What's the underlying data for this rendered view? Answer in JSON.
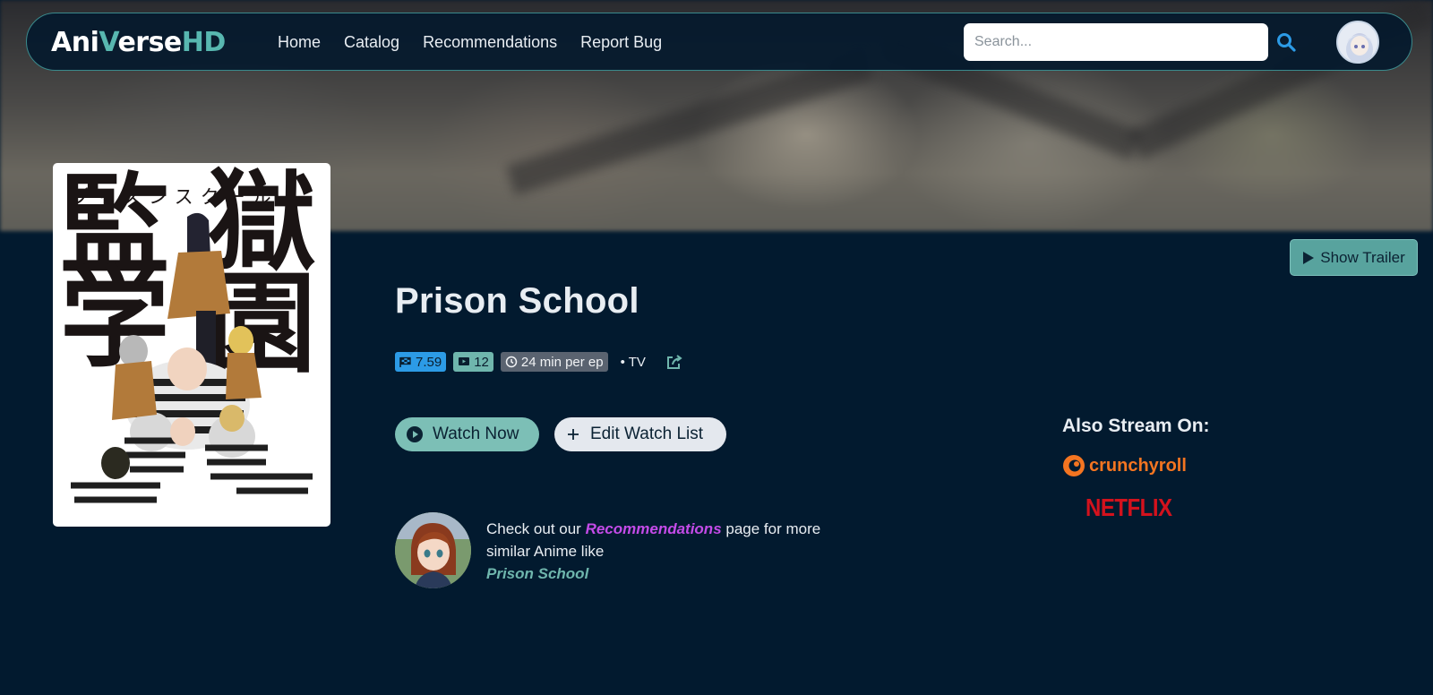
{
  "nav": {
    "logo_main": "Ani",
    "logo_v": "V",
    "logo_rest": "erse",
    "logo_hd": "HD",
    "links": [
      "Home",
      "Catalog",
      "Recommendations",
      "Report Bug"
    ],
    "search_placeholder": "Search..."
  },
  "anime": {
    "title": "Prison School",
    "score": "7.59",
    "episodes": "12",
    "duration": "24 min per ep",
    "type": "• TV"
  },
  "poster": {
    "kanji_left_top": "監",
    "kanji_right_top": "獄",
    "kanji_left_bottom": "学",
    "kanji_right_bottom": "園",
    "katakana": "プリズンスクール"
  },
  "actions": {
    "watch_now": "Watch Now",
    "edit_watch_list": "Edit Watch List",
    "show_trailer": "Show Trailer"
  },
  "recommendation": {
    "prefix": "Check out our ",
    "link": "Recommendations",
    "suffix": " page for more similar Anime like",
    "anime": "Prison School"
  },
  "streaming": {
    "title": "Also Stream On:",
    "services": [
      "crunchyroll",
      "NETFLIX"
    ]
  },
  "colors": {
    "background": "#021a2f",
    "accent_teal": "#58b7b0",
    "score_blue": "#2c9be6",
    "link_purple": "#c44be8",
    "crunchyroll_orange": "#f47521",
    "netflix_red": "#d3121d"
  }
}
